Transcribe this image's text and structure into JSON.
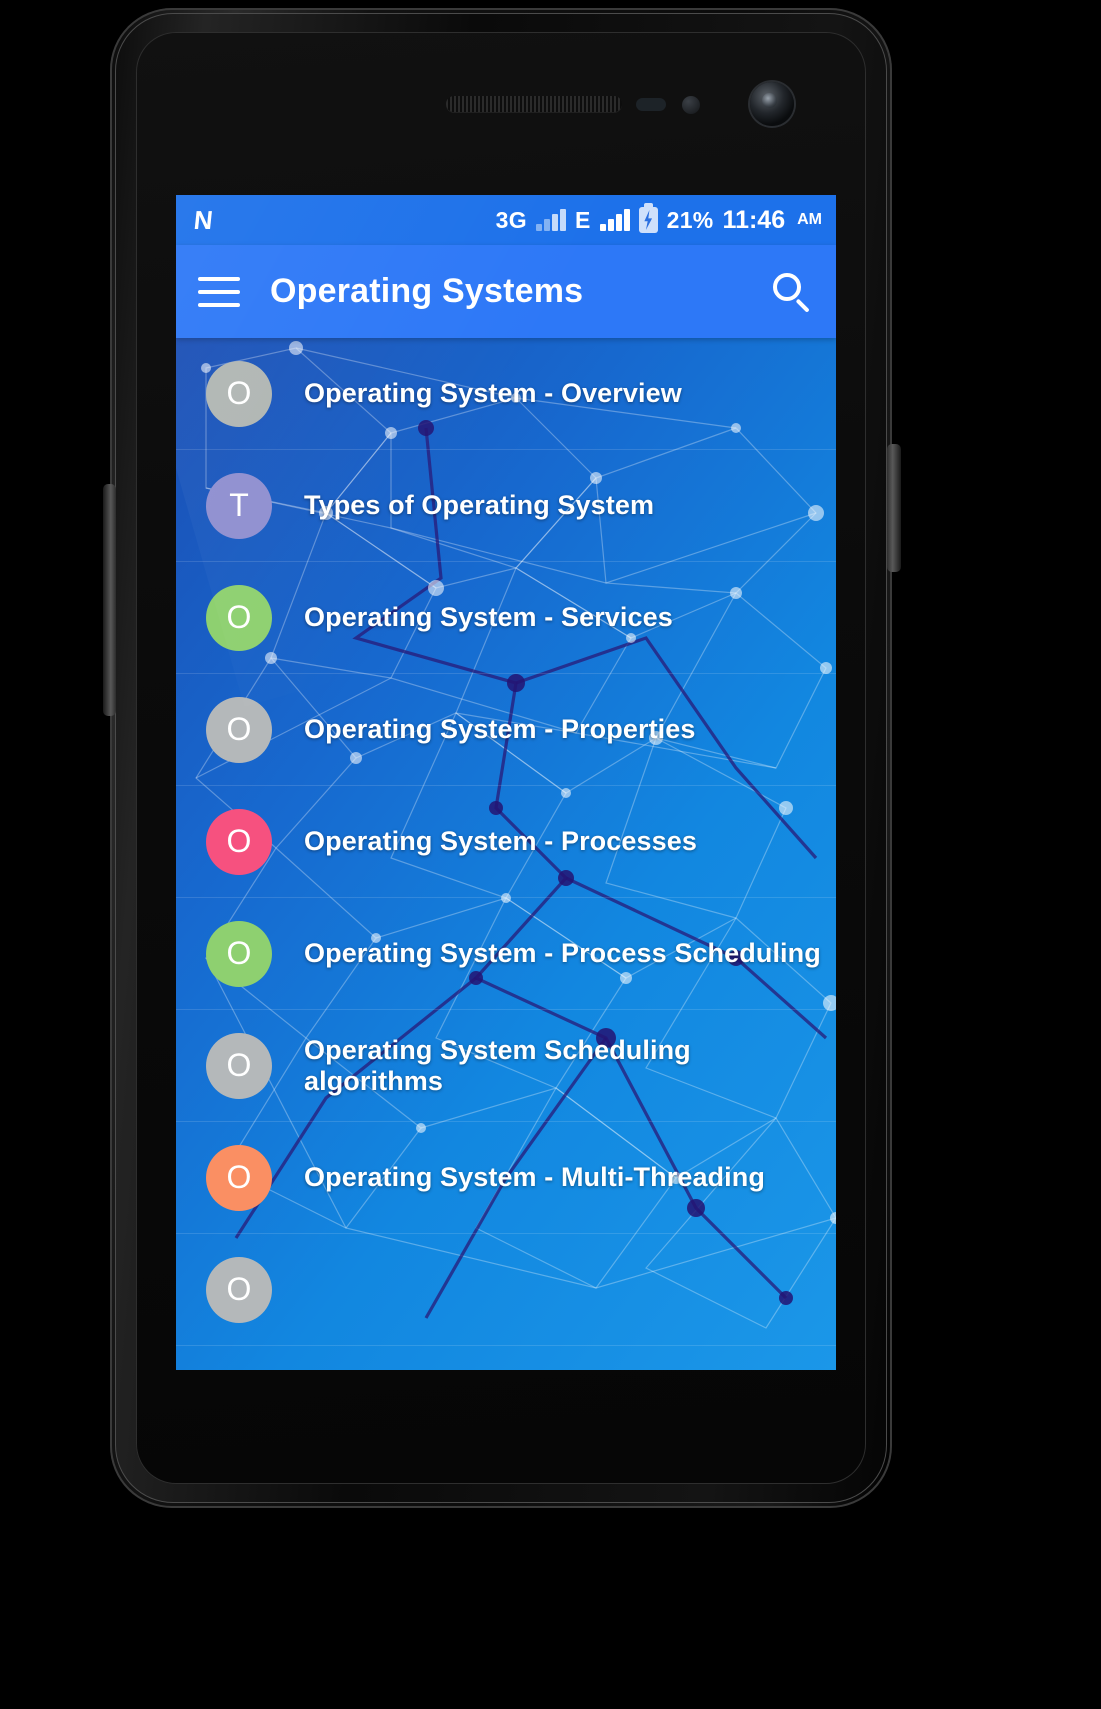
{
  "device": {
    "name": "android-phone-mockup"
  },
  "statusbar": {
    "logo": "N",
    "network_3g": "3G",
    "network_e": "E",
    "battery_percent": "21%",
    "time": "11:46",
    "ampm": "AM",
    "icons": {
      "signal_1": "signal-bars-icon",
      "signal_2": "signal-bars-icon",
      "battery": "battery-charging-icon"
    },
    "colors": {
      "bg": "#1d71ea",
      "fg": "#ffffff"
    }
  },
  "appbar": {
    "title": "Operating Systems",
    "menu_icon": "hamburger-menu-icon",
    "search_icon": "search-icon",
    "colors": {
      "bg": "#2d78f7",
      "fg": "#ffffff"
    }
  },
  "list": {
    "items": [
      {
        "letter": "O",
        "label": "Operating System - Overview",
        "color": "#b0b6b3"
      },
      {
        "letter": "T",
        "label": "Types of Operating System",
        "color": "#8f8fd0"
      },
      {
        "letter": "O",
        "label": "Operating System - Services",
        "color": "#8ed070"
      },
      {
        "letter": "O",
        "label": "Operating System - Properties",
        "color": "#b4b8ba"
      },
      {
        "letter": "O",
        "label": "Operating System - Processes",
        "color": "#f6517f"
      },
      {
        "letter": "O",
        "label": "Operating System - Process Scheduling",
        "color": "#8ed070"
      },
      {
        "letter": "O",
        "label": "Operating System Scheduling algorithms",
        "color": "#b4b8ba"
      },
      {
        "letter": "O",
        "label": "Operating System - Multi-Threading",
        "color": "#fa8f63"
      },
      {
        "letter": "O",
        "label": "",
        "color": "#b4b8ba"
      }
    ]
  },
  "theme": {
    "accent": "#2d78f7",
    "background_gradient_from": "#1b4fb5",
    "background_gradient_to": "#1b97e8"
  }
}
